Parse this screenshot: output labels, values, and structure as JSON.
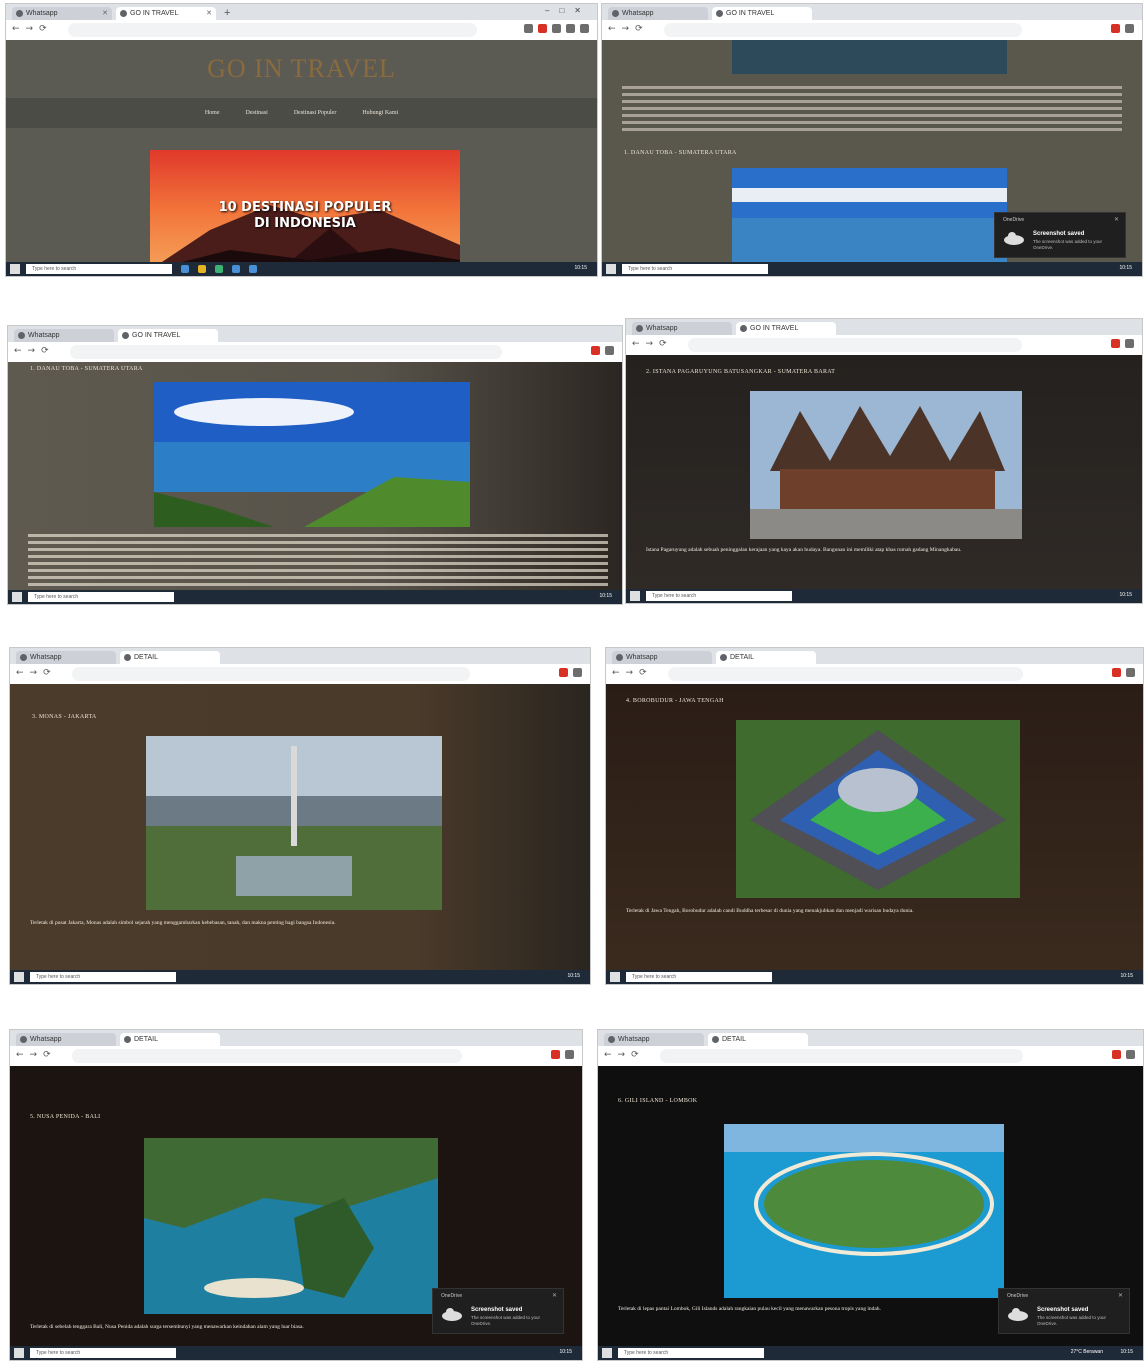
{
  "browser": {
    "tab1": "Whatsapp",
    "tab2": "GO IN TRAVEL",
    "tab1_short": "Whatsapp",
    "tab2_short": "DETAIL"
  },
  "site": {
    "brand": "GO IN TRAVEL",
    "menu": [
      "Home",
      "Destinasi",
      "Destinasi Populer",
      "Hubungi Kami"
    ],
    "hero_title_line1": "10 DESTINASI POPULER",
    "hero_title_line2": "DI INDONESIA"
  },
  "sections": {
    "toba": "1. DANAU TOBA - SUMATERA UTARA",
    "pagaruyung": "2. ISTANA PAGARUYUNG BATUSANGKAR - SUMATERA BARAT",
    "monas": "3. MONAS - JAKARTA",
    "borobudur": "4. BOROBUDUR - JAWA TENGAH",
    "nusapenida": "5. NUSA PENIDA - BALI",
    "gili": "6. GILI ISLAND - LOMBOK"
  },
  "snippets": {
    "pagaruyung_para": "Istana Pagaruyung adalah sebuah peninggalan kerajaan yang kaya akan budaya. Bangunan ini memiliki atap khas rumah gadang Minangkabau.",
    "monas_para": "Terletak di pusat Jakarta, Monas adalah simbol sejarah yang menggambarkan kebebasan, tanah, dan makna penting bagi bangsa Indonesia.",
    "borobudur_para": "Terletak di Jawa Tengah, Borobudur adalah candi Buddha terbesar di dunia yang menakjubkan dan menjadi warisan budaya dunia.",
    "nusapenida_para": "Terletak di sebelah tenggara Bali, Nusa Penida adalah surga tersembunyi yang menawarkan keindahan alam yang luar biasa.",
    "gili_para": "Terletak di lepas pantai Lombok, Gili Islands adalah rangkaian pulau kecil yang menawarkan pesona tropis yang indah."
  },
  "taskbar": {
    "search": "Type here to search",
    "weather": "27°C Berawan",
    "time": "10:15"
  },
  "toast": {
    "app": "OneDrive",
    "title": "Screenshot saved",
    "body": "The screenshot was added to your OneDrive."
  }
}
